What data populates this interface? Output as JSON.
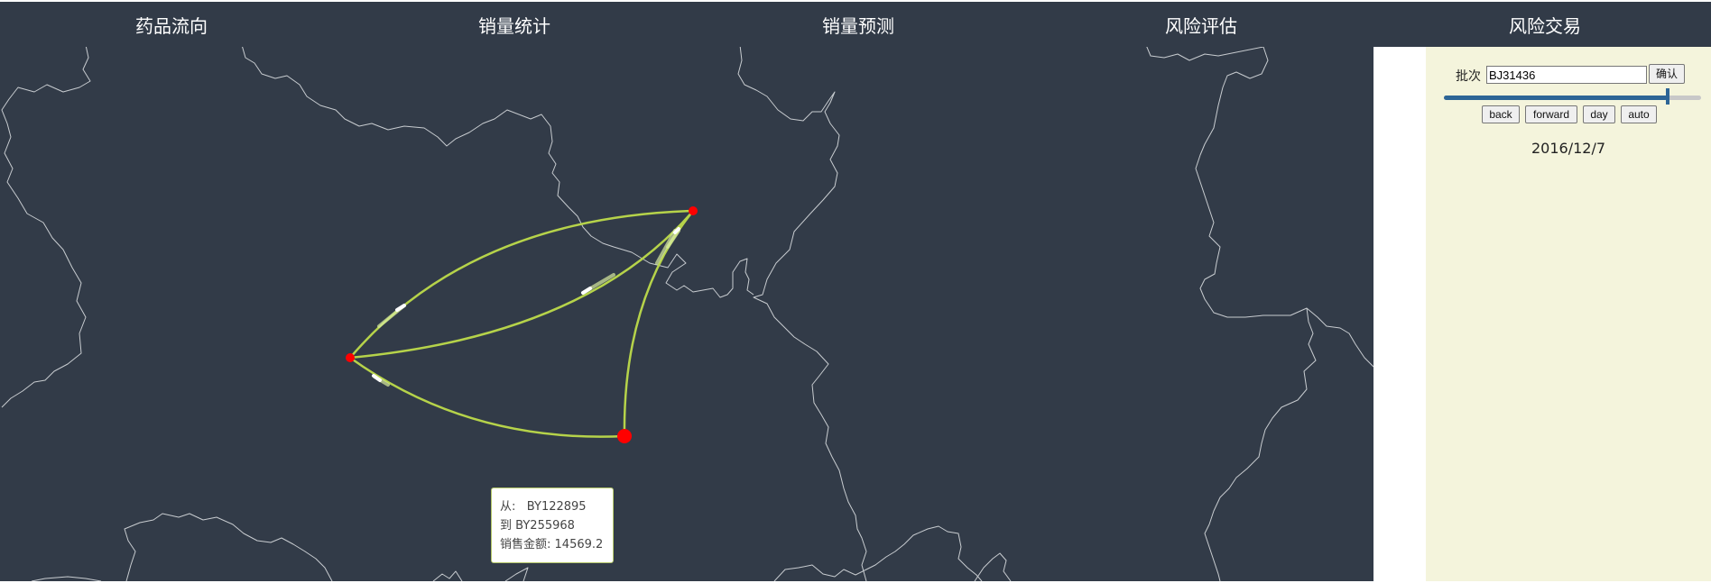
{
  "nav": {
    "items": [
      {
        "label": "药品流向"
      },
      {
        "label": "销量统计"
      },
      {
        "label": "销量预测"
      },
      {
        "label": "风险评估"
      },
      {
        "label": "风险交易"
      }
    ]
  },
  "controls": {
    "batch_label": "批次",
    "batch_value": "BJ31436",
    "confirm_label": "确认",
    "back_label": "back",
    "forward_label": "forward",
    "day_label": "day",
    "auto_label": "auto",
    "date": "2016/12/7",
    "slider_fraction": 0.87
  },
  "tooltip": {
    "from_label": "从:",
    "from_value": "BY122895",
    "to_label": "到",
    "to_value": "BY255968",
    "amount_label": "销售金额:",
    "amount_value": "14569.2"
  },
  "colors": {
    "map_background": "#323b48",
    "border_line": "#c8ccd0",
    "flow_line": "#b6d34a",
    "node": "#ff0000",
    "panel_background": "#f4f4dc",
    "slider": "#2d6596"
  }
}
